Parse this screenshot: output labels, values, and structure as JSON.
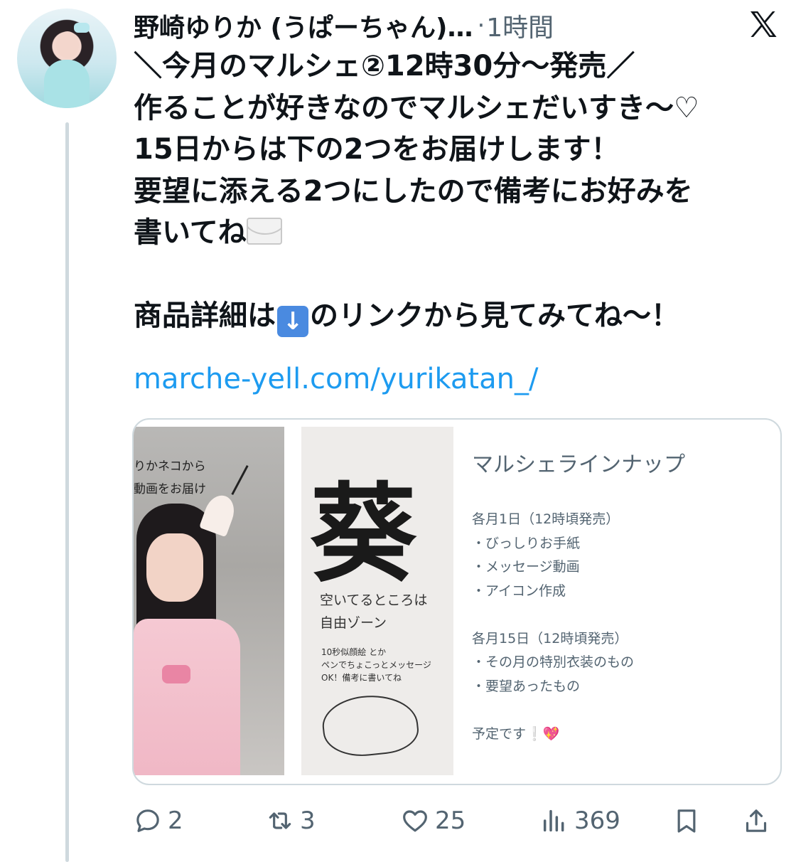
{
  "tweet": {
    "author": "野崎ゆりか (うぱーちゃん)…",
    "separator": "·",
    "time": "1時間",
    "lines": [
      "＼今月のマルシェ②12時30分〜発売／",
      "作ることが好きなのでマルシェだいすき〜♡",
      "15日からは下の2つをお届けします！",
      "要望に添える2つにしたので備考にお好みを",
      "書いてね"
    ],
    "detail_before": "商品詳細は",
    "detail_after": "のリンクから見てみてね〜！",
    "link": "marche-yell.com/yurikatan_/"
  },
  "card": {
    "photo1_caption_line1": "りかネコから",
    "photo1_caption_line2": "動画をお届け",
    "photo2_kanji": "葵",
    "photo2_text1": "空いてるところは",
    "photo2_text2": "自由ゾーン",
    "photo2_small1": "10秒似顔絵 とか",
    "photo2_small2": "ペンでちょこっとメッセージ",
    "photo2_small3": "OK！備考に書いてね",
    "title": "マルシェラインナップ",
    "lines": [
      "各月1日（12時頃発売）",
      "・びっしりお手紙",
      "・メッセージ動画",
      "・アイコン作成",
      "",
      "各月15日（12時頃発売）",
      "・その月の特別衣装のもの",
      "・要望あったもの",
      "",
      "予定です❕💖"
    ]
  },
  "actions": {
    "replies": "2",
    "reposts": "3",
    "likes": "25",
    "views": "369"
  },
  "icons": {
    "envelope": "envelope-icon",
    "down_arrow": "down-arrow-icon",
    "reply": "reply-icon",
    "repost": "repost-icon",
    "like": "heart-icon",
    "views": "views-icon",
    "bookmark": "bookmark-icon",
    "share": "share-icon",
    "logo": "x-logo-icon"
  },
  "colors": {
    "link": "#1d9bf0",
    "secondary_text": "#536471",
    "border": "#cfd9de"
  }
}
